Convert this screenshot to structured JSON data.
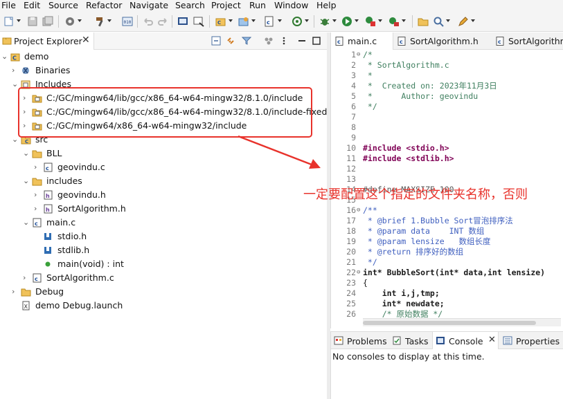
{
  "menu": {
    "items": [
      "File",
      "Edit",
      "Source",
      "Refactor",
      "Navigate",
      "Search",
      "Project",
      "Run",
      "Window",
      "Help"
    ]
  },
  "toolbar": {
    "icons": [
      "new-icon",
      "save-icon",
      "save-all-icon",
      "build-config-icon",
      "hammer-build-icon",
      "binary-icon",
      "undo-icon",
      "redo-icon",
      "console-icon",
      "terminal-icon",
      "new-project-icon",
      "new-class-icon",
      "new-source-icon",
      "target-icon",
      "debug-icon",
      "run-icon",
      "run-coverage-icon",
      "external-tools-icon",
      "open-folder-icon",
      "search-icon",
      "pen-icon"
    ]
  },
  "explorer": {
    "tab_label": "Project Explorer",
    "close_glyph": "✕",
    "tree": [
      {
        "label": "demo",
        "icon": "c-project-icon",
        "expanded": true,
        "level": 0
      },
      {
        "label": "Binaries",
        "icon": "binaries-icon",
        "expanded": false,
        "level": 1
      },
      {
        "label": "Includes",
        "icon": "includes-icon",
        "expanded": true,
        "level": 1
      },
      {
        "label": "C:/GC/mingw64/lib/gcc/x86_64-w64-mingw32/8.1.0/include",
        "icon": "include-folder-icon",
        "expanded": false,
        "level": 2
      },
      {
        "label": "C:/GC/mingw64/lib/gcc/x86_64-w64-mingw32/8.1.0/include-fixed",
        "icon": "include-folder-icon",
        "expanded": false,
        "level": 2
      },
      {
        "label": "C:/GC/mingw64/x86_64-w64-mingw32/include",
        "icon": "include-folder-icon",
        "expanded": false,
        "level": 2
      },
      {
        "label": "src",
        "icon": "source-folder-icon",
        "expanded": true,
        "level": 1
      },
      {
        "label": "BLL",
        "icon": "folder-icon",
        "expanded": true,
        "level": 2
      },
      {
        "label": "geovindu.c",
        "icon": "c-file-icon",
        "expanded": false,
        "level": 3
      },
      {
        "label": "includes",
        "icon": "folder-icon",
        "expanded": true,
        "level": 2
      },
      {
        "label": "geovindu.h",
        "icon": "h-file-icon",
        "expanded": false,
        "level": 3
      },
      {
        "label": "SortAlgorithm.h",
        "icon": "h-file-icon",
        "expanded": false,
        "level": 3
      },
      {
        "label": "main.c",
        "icon": "c-file-icon",
        "expanded": true,
        "level": 2
      },
      {
        "label": "stdio.h",
        "icon": "include-ref-icon",
        "expanded": null,
        "level": 3
      },
      {
        "label": "stdlib.h",
        "icon": "include-ref-icon",
        "expanded": null,
        "level": 3
      },
      {
        "label": "main(void) : int",
        "icon": "function-icon",
        "expanded": null,
        "level": 3
      },
      {
        "label": "SortAlgorithm.c",
        "icon": "c-file-icon",
        "expanded": false,
        "level": 2
      },
      {
        "label": "Debug",
        "icon": "folder-icon",
        "expanded": false,
        "level": 1
      },
      {
        "label": "demo Debug.launch",
        "icon": "launch-file-icon",
        "expanded": null,
        "level": 1
      }
    ]
  },
  "editor": {
    "tabs": [
      {
        "label": "main.c",
        "active": true
      },
      {
        "label": "SortAlgorithm.h",
        "active": false
      },
      {
        "label": "SortAlgorithm.",
        "active": false
      }
    ],
    "lines": [
      {
        "n": "1",
        "text": "/*"
      },
      {
        "n": "2",
        "text": " * SortAlgorithm.c"
      },
      {
        "n": "3",
        "text": " *"
      },
      {
        "n": "4",
        "text": " *  Created on: 2023年11月3日"
      },
      {
        "n": "5",
        "text": " *      Author: geovindu"
      },
      {
        "n": "6",
        "text": " */"
      },
      {
        "n": "7",
        "text": ""
      },
      {
        "n": "8",
        "text": ""
      },
      {
        "n": "9",
        "text": ""
      },
      {
        "n": "10",
        "text": "#include <stdio.h>"
      },
      {
        "n": "11",
        "text": "#include <stdlib.h>"
      },
      {
        "n": "12",
        "text": ""
      },
      {
        "n": "13",
        "text": ""
      },
      {
        "n": "14",
        "text": "#define MAXSIZE 100"
      },
      {
        "n": "15",
        "text": ""
      },
      {
        "n": "16",
        "text": "/**"
      },
      {
        "n": "17",
        "text": " * @brief 1.Bubble Sort冒泡排序法"
      },
      {
        "n": "18",
        "text": " * @param data    INT 数组"
      },
      {
        "n": "19",
        "text": " * @param lensize   数组长度"
      },
      {
        "n": "20",
        "text": " * @return 排序好的数组"
      },
      {
        "n": "21",
        "text": " */"
      },
      {
        "n": "22",
        "text": "int* BubbleSort(int* data,int lensize)"
      },
      {
        "n": "23",
        "text": "{"
      },
      {
        "n": "24",
        "text": "    int i,j,tmp;"
      },
      {
        "n": "25",
        "text": "    int* newdate;"
      },
      {
        "n": "26",
        "text": "    /* 原始数据 */"
      }
    ]
  },
  "console": {
    "tabs": [
      {
        "label": "Problems",
        "icon": "problems-icon"
      },
      {
        "label": "Tasks",
        "icon": "tasks-icon"
      },
      {
        "label": "Console",
        "icon": "console-icon"
      },
      {
        "label": "Properties",
        "icon": "properties-icon"
      }
    ],
    "message": "No consoles to display at this time.",
    "close_glyph": "✕"
  },
  "annotation": {
    "text": "一定要配置这个指定的文件夹名称，否则",
    "color": "#e8322b"
  }
}
